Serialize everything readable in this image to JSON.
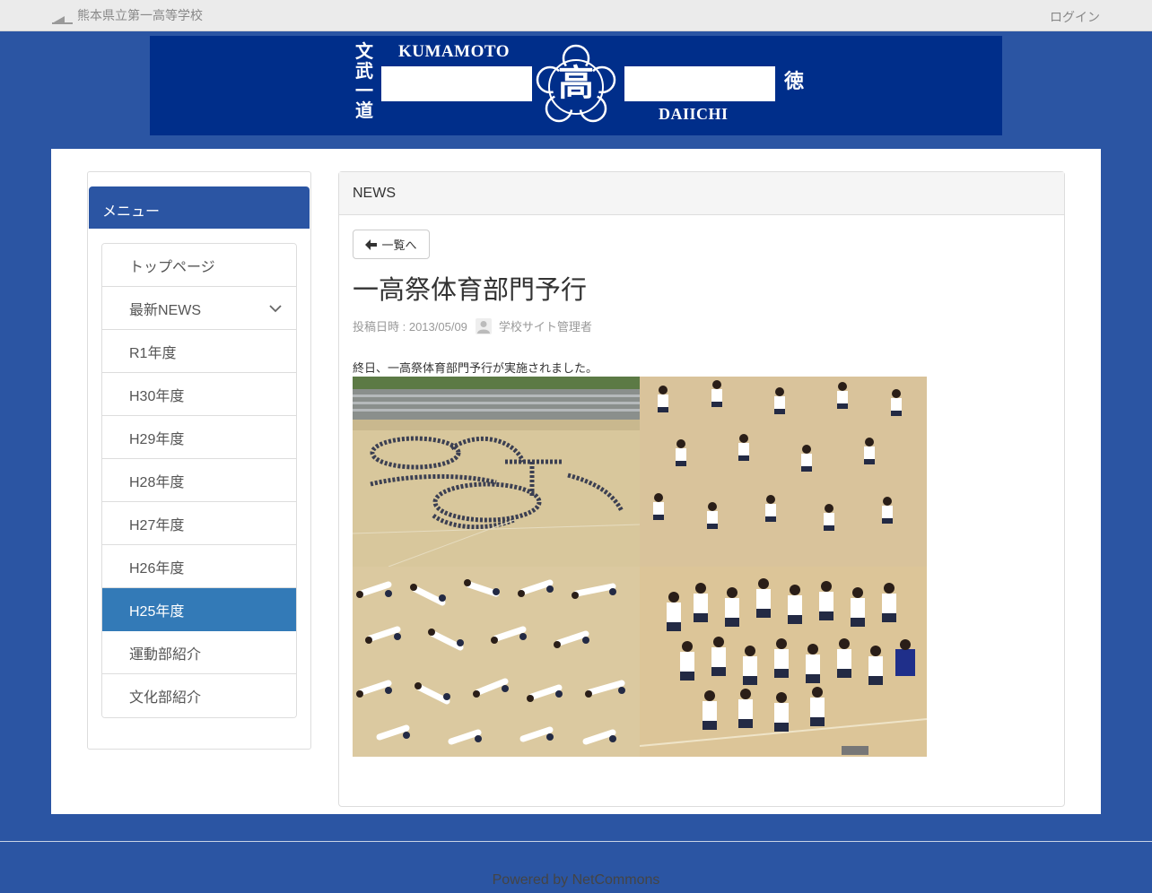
{
  "topbar": {
    "site_name": "熊本県立第一高等学校",
    "login": "ログイン"
  },
  "banner": {
    "left_vertical": "文武一道",
    "crest_char": "高",
    "word_top": "KUMAMOTO",
    "word_bottom": "DAIICHI",
    "right_vertical": "徳"
  },
  "sidebar": {
    "heading": "メニュー",
    "items": [
      {
        "label": "トップページ",
        "active": false
      },
      {
        "label": "最新NEWS",
        "active": false,
        "has_children": true
      },
      {
        "label": "R1年度",
        "active": false
      },
      {
        "label": "H30年度",
        "active": false
      },
      {
        "label": "H29年度",
        "active": false
      },
      {
        "label": "H28年度",
        "active": false
      },
      {
        "label": "H27年度",
        "active": false
      },
      {
        "label": "H26年度",
        "active": false
      },
      {
        "label": "H25年度",
        "active": true
      },
      {
        "label": "運動部紹介",
        "active": false
      },
      {
        "label": "文化部紹介",
        "active": false
      }
    ]
  },
  "news": {
    "header": "NEWS",
    "back_label": "一覧へ",
    "title": "一高祭体育部門予行",
    "posted_label": "投稿日時 : 2013/05/09",
    "author": "学校サイト管理者",
    "body": "終日、一高祭体育部門予行が実施されました。"
  },
  "footer": {
    "prefix": "Powered by ",
    "link": "NetCommons"
  },
  "colors": {
    "background": "#2b55a3",
    "banner": "#002e8a",
    "active_item": "#337ab7"
  }
}
